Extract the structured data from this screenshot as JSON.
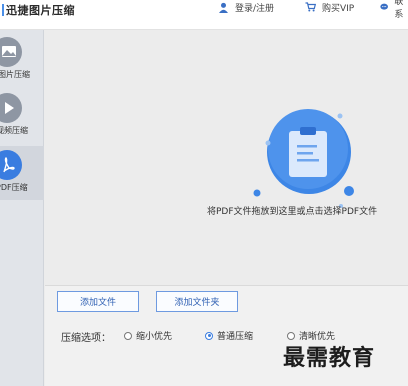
{
  "app": {
    "title": "迅捷图片压缩"
  },
  "topbar": {
    "login": "登录/注册",
    "vip": "购买VIP",
    "contact": "联系"
  },
  "sidebar": {
    "items": [
      {
        "label": "图片压缩",
        "icon": "image-icon",
        "active": false
      },
      {
        "label": "视频压缩",
        "icon": "play-icon",
        "active": false
      },
      {
        "label": "PDF压缩",
        "icon": "pdf-icon",
        "active": true
      }
    ]
  },
  "drop_area": {
    "hint": "将PDF文件拖放到这里或点击选择PDF文件"
  },
  "buttons": {
    "add_file": "添加文件",
    "add_folder": "添加文件夹"
  },
  "compress": {
    "label": "压缩选项：",
    "options": [
      {
        "label": "缩小优先",
        "selected": false
      },
      {
        "label": "普通压缩",
        "selected": true
      },
      {
        "label": "清晰优先",
        "selected": false
      }
    ]
  },
  "watermark": "最需教育",
  "colors": {
    "accent": "#3a7de0",
    "sidebar_bg": "#e1e4e9"
  }
}
